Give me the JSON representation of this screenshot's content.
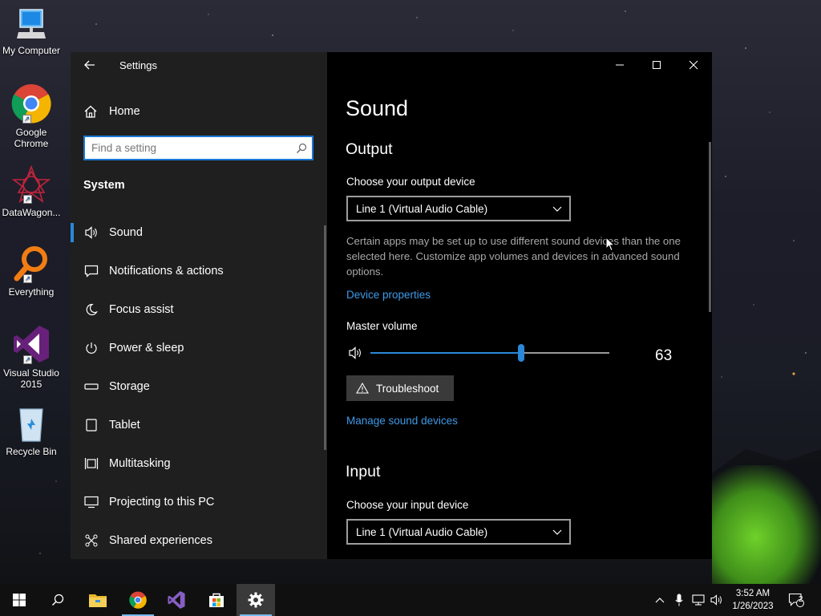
{
  "desktop": {
    "icons": [
      {
        "label": "My Computer"
      },
      {
        "label": "Google Chrome"
      },
      {
        "label": "DataWagon..."
      },
      {
        "label": "Everything"
      },
      {
        "label": "Visual Studio 2015"
      },
      {
        "label": "Recycle Bin"
      }
    ]
  },
  "window": {
    "app_title": "Settings",
    "controls": [
      "minimize-icon",
      "maximize-icon",
      "close-icon"
    ]
  },
  "nav": {
    "home_label": "Home",
    "search_placeholder": "Find a setting",
    "section_title": "System",
    "items": [
      {
        "label": "Sound",
        "icon": "speaker-icon",
        "selected": true
      },
      {
        "label": "Notifications & actions",
        "icon": "notification-icon"
      },
      {
        "label": "Focus assist",
        "icon": "moon-icon"
      },
      {
        "label": "Power & sleep",
        "icon": "power-icon"
      },
      {
        "label": "Storage",
        "icon": "storage-icon"
      },
      {
        "label": "Tablet",
        "icon": "tablet-icon"
      },
      {
        "label": "Multitasking",
        "icon": "multitasking-icon"
      },
      {
        "label": "Projecting to this PC",
        "icon": "projecting-icon"
      },
      {
        "label": "Shared experiences",
        "icon": "shared-experiences-icon"
      }
    ]
  },
  "content": {
    "page_title": "Sound",
    "output": {
      "heading": "Output",
      "device_label": "Choose your output device",
      "device_value": "Line 1 (Virtual Audio Cable)",
      "description": "Certain apps may be set up to use different sound devices than the one selected here. Customize app volumes and devices in advanced sound options.",
      "device_properties_link": "Device properties",
      "master_volume_label": "Master volume",
      "master_volume_value": "63",
      "master_volume_fraction": 0.63,
      "troubleshoot_label": "Troubleshoot",
      "manage_devices_link": "Manage sound devices"
    },
    "input": {
      "heading": "Input",
      "device_label": "Choose your input device",
      "device_value": "Line 1 (Virtual Audio Cable)"
    }
  },
  "taskbar": {
    "apps": [
      "windows-start-icon",
      "search-icon",
      "file-explorer-icon",
      "chrome-icon",
      "visual-studio-icon",
      "store-icon",
      "settings-icon"
    ],
    "time": "3:52 AM",
    "date": "1/26/2023",
    "notification_count": "2"
  },
  "colors": {
    "accent": "#2b88d8",
    "link": "#3e9ae8",
    "nav_bg": "#1f1f1f",
    "content_bg": "#000000"
  }
}
